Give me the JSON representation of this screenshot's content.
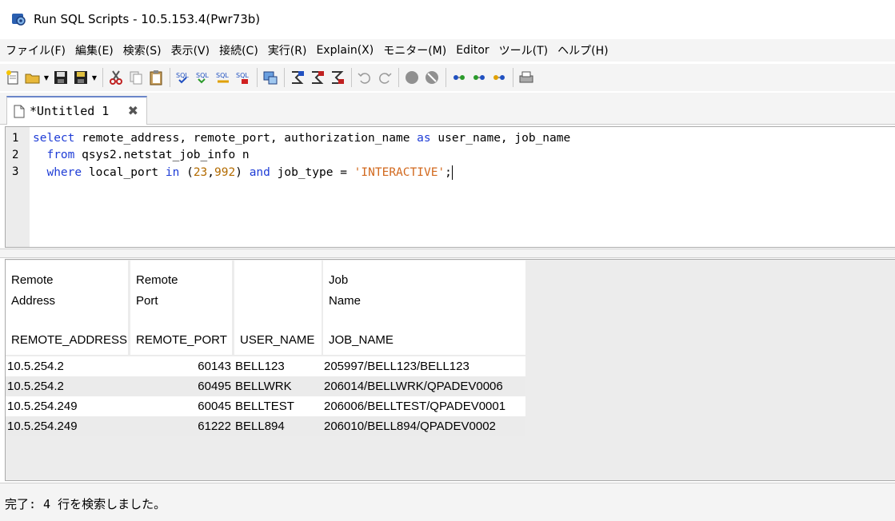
{
  "window": {
    "title": "Run SQL Scripts - 10.5.153.4(Pwr73b)"
  },
  "menu": [
    "ファイル(F)",
    "編集(E)",
    "検索(S)",
    "表示(V)",
    "接続(C)",
    "実行(R)",
    "Explain(X)",
    "モニター(M)",
    "Editor",
    "ツール(T)",
    "ヘルプ(H)"
  ],
  "tab": {
    "label": "*Untitled 1",
    "close": "✖"
  },
  "editor": {
    "line_numbers": [
      "1",
      "2",
      "3"
    ],
    "lines": [
      [
        {
          "t": "select",
          "c": "kw"
        },
        {
          "t": " remote_address, remote_port, authorization_name ",
          "c": ""
        },
        {
          "t": "as",
          "c": "kw"
        },
        {
          "t": " user_name, job_name",
          "c": ""
        }
      ],
      [
        {
          "t": "  ",
          "c": ""
        },
        {
          "t": "from",
          "c": "kw"
        },
        {
          "t": " qsys2.netstat_job_info n",
          "c": ""
        }
      ],
      [
        {
          "t": "  ",
          "c": ""
        },
        {
          "t": "where",
          "c": "kw"
        },
        {
          "t": " local_port ",
          "c": ""
        },
        {
          "t": "in",
          "c": "kw"
        },
        {
          "t": " (",
          "c": ""
        },
        {
          "t": "23",
          "c": "num"
        },
        {
          "t": ",",
          "c": ""
        },
        {
          "t": "992",
          "c": "num"
        },
        {
          "t": ") ",
          "c": ""
        },
        {
          "t": "and",
          "c": "kw"
        },
        {
          "t": " job_type = ",
          "c": ""
        },
        {
          "t": "'INTERACTIVE'",
          "c": "str"
        },
        {
          "t": ";",
          "c": ""
        }
      ]
    ]
  },
  "results": {
    "headers": [
      {
        "line1": "Remote",
        "line2": "Address",
        "col": "REMOTE_ADDRESS"
      },
      {
        "line1": "Remote",
        "line2": "Port",
        "col": "REMOTE_PORT"
      },
      {
        "line1": "",
        "line2": "",
        "col": "USER_NAME"
      },
      {
        "line1": "Job",
        "line2": "Name",
        "col": "JOB_NAME"
      }
    ],
    "rows": [
      [
        "10.5.254.2",
        "60143",
        "BELL123",
        "205997/BELL123/BELL123"
      ],
      [
        "10.5.254.2",
        "60495",
        "BELLWRK",
        "206014/BELLWRK/QPADEV0006"
      ],
      [
        "10.5.254.249",
        "60045",
        "BELLTEST",
        "206006/BELLTEST/QPADEV0001"
      ],
      [
        "10.5.254.249",
        "61222",
        "BELL894",
        "206010/BELL894/QPADEV0002"
      ]
    ]
  },
  "status": {
    "text": "完了: 4 行を検索しました。"
  }
}
